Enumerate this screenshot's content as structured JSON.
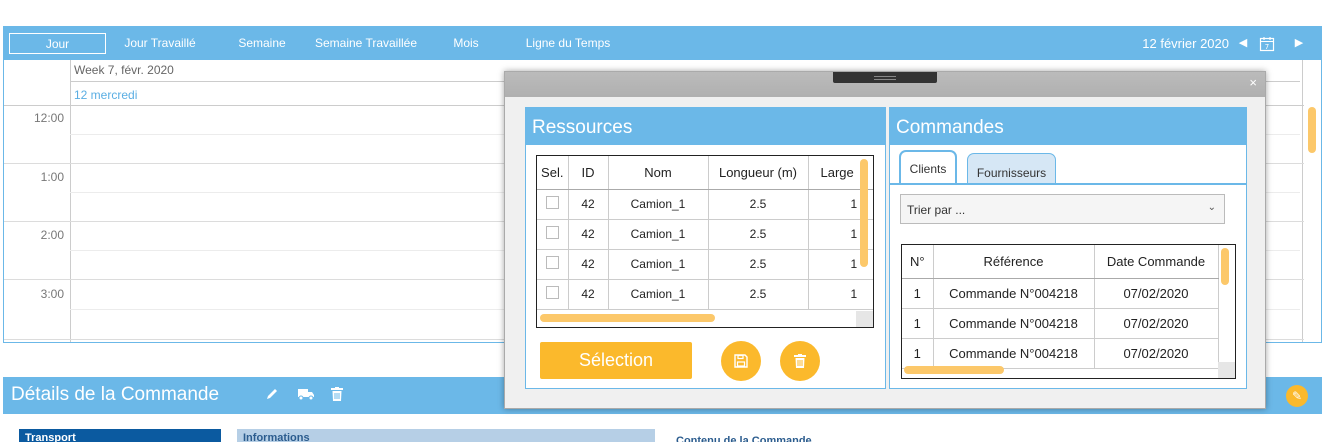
{
  "scheduler": {
    "views": [
      "Jour",
      "Jour Travaillé",
      "Semaine",
      "Semaine Travaillée",
      "Mois",
      "Ligne du Temps"
    ],
    "active_view": "Jour",
    "current_date": "12 février 2020",
    "week_label": "Week 7, févr. 2020",
    "day_label": "12 mercredi",
    "times": [
      "12:00",
      "1:00",
      "2:00",
      "3:00"
    ]
  },
  "details": {
    "title": "Détails de la Commande",
    "transport_tab": "Transport",
    "info_tab": "Informations",
    "content_label": "Contenu de la Commande"
  },
  "modal": {
    "close_glyph": "×",
    "resources": {
      "title": "Ressources",
      "columns": [
        "Sel.",
        "ID",
        "Nom",
        "Longueur (m)",
        "Large"
      ],
      "rows": [
        {
          "id": "42",
          "nom": "Camion_1",
          "longueur": "2.5",
          "large": "1"
        },
        {
          "id": "42",
          "nom": "Camion_1",
          "longueur": "2.5",
          "large": "1"
        },
        {
          "id": "42",
          "nom": "Camion_1",
          "longueur": "2.5",
          "large": "1"
        },
        {
          "id": "42",
          "nom": "Camion_1",
          "longueur": "2.5",
          "large": "1"
        }
      ],
      "selection_button": "Sélection"
    },
    "orders": {
      "title": "Commandes",
      "tabs": [
        "Clients",
        "Fournisseurs"
      ],
      "active_tab": "Clients",
      "sort_placeholder": "Trier par ...",
      "columns": [
        "N°",
        "Référence",
        "Date Commande"
      ],
      "rows": [
        {
          "n": "1",
          "ref": "Commande N°004218",
          "date": "07/02/2020"
        },
        {
          "n": "1",
          "ref": "Commande N°004218",
          "date": "07/02/2020"
        },
        {
          "n": "1",
          "ref": "Commande N°004218",
          "date": "07/02/2020"
        }
      ]
    }
  },
  "icons": {
    "prev": "chevron-left-icon",
    "next": "chevron-right-icon",
    "calendar": "calendar-icon",
    "edit": "pencil-icon",
    "truck": "truck-icon",
    "trash": "trash-icon",
    "pin": "pin-icon",
    "save": "save-icon",
    "close": "close-icon"
  },
  "colors": {
    "accent": "#6bb8e8",
    "button": "#fbb92c",
    "dark_blue": "#0b5aa0"
  }
}
